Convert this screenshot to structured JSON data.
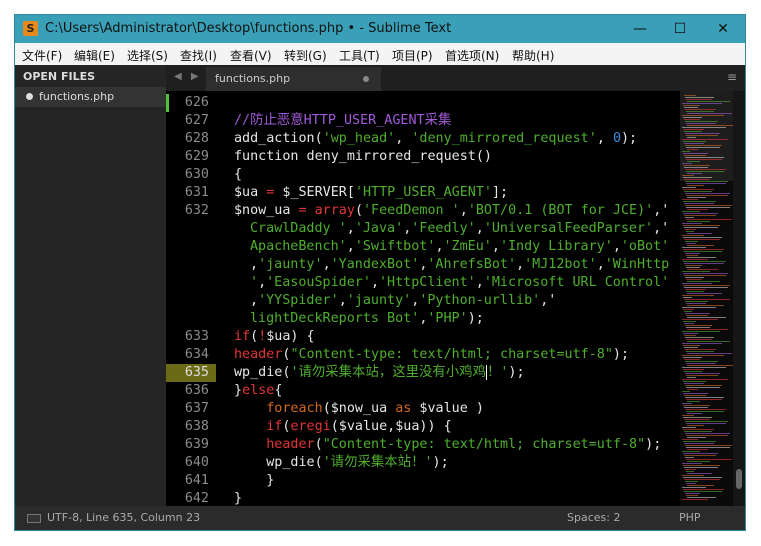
{
  "window": {
    "title": "C:\\Users\\Administrator\\Desktop\\functions.php • - Sublime Text",
    "app_icon": "S",
    "controls": {
      "minimize": "—",
      "maximize": "☐",
      "close": "✕"
    }
  },
  "menu": [
    "文件(F)",
    "编辑(E)",
    "选择(S)",
    "查找(I)",
    "查看(V)",
    "转到(G)",
    "工具(T)",
    "项目(P)",
    "首选项(N)",
    "帮助(H)"
  ],
  "sidebar": {
    "header": "OPEN FILES",
    "files": [
      {
        "name": "functions.php"
      }
    ]
  },
  "tabs": [
    {
      "label": "functions.php",
      "dirty": true
    }
  ],
  "tab_nav": "◀ ▶",
  "tab_menu_icon": "≡",
  "editor": {
    "modified_line": 626,
    "current_line": 635,
    "lines": [
      {
        "n": "626",
        "t": []
      },
      {
        "n": "627",
        "t": [
          [
            "//防止恶意HTTP_USER_AGENT采集",
            "c"
          ]
        ]
      },
      {
        "n": "628",
        "t": [
          [
            "add_action(",
            ""
          ],
          [
            "'wp_head'",
            "s"
          ],
          [
            ", ",
            ""
          ],
          [
            "'deny_mirrored_request'",
            "s"
          ],
          [
            ", ",
            ""
          ],
          [
            "0",
            "n"
          ],
          [
            ");",
            ""
          ]
        ]
      },
      {
        "n": "629",
        "t": [
          [
            "function deny_mirrored_request()",
            ""
          ]
        ]
      },
      {
        "n": "630",
        "t": [
          [
            "{",
            ""
          ]
        ]
      },
      {
        "n": "631",
        "t": [
          [
            "$ua ",
            ""
          ],
          [
            "=",
            "k"
          ],
          [
            " $_SERVER[",
            ""
          ],
          [
            "'HTTP_USER_AGENT'",
            "s"
          ],
          [
            "];",
            ""
          ]
        ]
      },
      {
        "n": "632",
        "t": [
          [
            "$now_ua ",
            ""
          ],
          [
            "= array",
            "k"
          ],
          [
            "(",
            ""
          ],
          [
            "'FeedDemon '",
            "s"
          ],
          [
            ",",
            ""
          ],
          [
            "'BOT/0.1 (BOT for JCE)'",
            "s"
          ],
          [
            ",'",
            ""
          ]
        ]
      },
      {
        "n": "",
        "t": [
          [
            "CrawlDaddy '",
            "s"
          ],
          [
            ",",
            ""
          ],
          [
            "'Java'",
            "s"
          ],
          [
            ",",
            ""
          ],
          [
            "'Feedly'",
            "s"
          ],
          [
            ",",
            ""
          ],
          [
            "'UniversalFeedParser'",
            "s"
          ],
          [
            ",'",
            ""
          ]
        ]
      },
      {
        "n": "",
        "t": [
          [
            "ApacheBench'",
            "s"
          ],
          [
            ",",
            ""
          ],
          [
            "'Swiftbot'",
            "s"
          ],
          [
            ",",
            ""
          ],
          [
            "'ZmEu'",
            "s"
          ],
          [
            ",",
            ""
          ],
          [
            "'Indy Library'",
            "s"
          ],
          [
            ",",
            ""
          ],
          [
            "'oBot'",
            "s"
          ]
        ]
      },
      {
        "n": "",
        "t": [
          [
            ",",
            ""
          ],
          [
            "'jaunty'",
            "s"
          ],
          [
            ",",
            ""
          ],
          [
            "'YandexBot'",
            "s"
          ],
          [
            ",",
            ""
          ],
          [
            "'AhrefsBot'",
            "s"
          ],
          [
            ",",
            ""
          ],
          [
            "'MJ12bot'",
            "s"
          ],
          [
            ",",
            ""
          ],
          [
            "'WinHttp",
            "s"
          ]
        ]
      },
      {
        "n": "",
        "t": [
          [
            "'",
            "s"
          ],
          [
            ",",
            ""
          ],
          [
            "'EasouSpider'",
            "s"
          ],
          [
            ",",
            ""
          ],
          [
            "'HttpClient'",
            "s"
          ],
          [
            ",",
            ""
          ],
          [
            "'Microsoft URL Control'",
            "s"
          ]
        ]
      },
      {
        "n": "",
        "t": [
          [
            ",",
            ""
          ],
          [
            "'YYSpider'",
            "s"
          ],
          [
            ",",
            ""
          ],
          [
            "'jaunty'",
            "s"
          ],
          [
            ",",
            ""
          ],
          [
            "'Python-urllib'",
            "s"
          ],
          [
            ",'",
            ""
          ]
        ]
      },
      {
        "n": "",
        "t": [
          [
            "lightDeckReports Bot'",
            "s"
          ],
          [
            ",",
            ""
          ],
          [
            "'PHP'",
            "s"
          ],
          [
            ");",
            ""
          ]
        ]
      },
      {
        "n": "633",
        "t": [
          [
            "if",
            "k"
          ],
          [
            "(",
            ""
          ],
          [
            "!",
            "k"
          ],
          [
            "$ua) {",
            ""
          ]
        ]
      },
      {
        "n": "634",
        "t": [
          [
            "header",
            "k"
          ],
          [
            "(",
            ""
          ],
          [
            "\"Content-type: text/html; charset=utf-8\"",
            "s"
          ],
          [
            ");",
            ""
          ]
        ]
      },
      {
        "n": "635",
        "t": [
          [
            "wp_die(",
            ""
          ],
          [
            "'请勿采集本站，这里没有小鸡鸡",
            "s"
          ],
          [
            "|",
            "cursor"
          ],
          [
            "！'",
            "s"
          ],
          [
            ");",
            ""
          ]
        ]
      },
      {
        "n": "636",
        "t": [
          [
            "}",
            ""
          ],
          [
            "else",
            "k"
          ],
          [
            "{",
            ""
          ]
        ]
      },
      {
        "n": "637",
        "t": [
          [
            "    ",
            ""
          ],
          [
            "foreach",
            "o"
          ],
          [
            "($now_ua ",
            ""
          ],
          [
            "as",
            "o"
          ],
          [
            " $value )",
            ""
          ]
        ]
      },
      {
        "n": "638",
        "t": [
          [
            "    ",
            ""
          ],
          [
            "if",
            "k"
          ],
          [
            "(",
            ""
          ],
          [
            "eregi",
            "k"
          ],
          [
            "($value,$ua)) {",
            ""
          ]
        ]
      },
      {
        "n": "639",
        "t": [
          [
            "    ",
            ""
          ],
          [
            "header",
            "k"
          ],
          [
            "(",
            ""
          ],
          [
            "\"Content-type: text/html; charset=utf-8\"",
            "s"
          ],
          [
            ");",
            ""
          ]
        ]
      },
      {
        "n": "640",
        "t": [
          [
            "    wp_die(",
            ""
          ],
          [
            "'请勿采集本站！'",
            "s"
          ],
          [
            ");",
            ""
          ]
        ]
      },
      {
        "n": "641",
        "t": [
          [
            "    }",
            ""
          ]
        ]
      },
      {
        "n": "642",
        "t": [
          [
            "}",
            ""
          ]
        ]
      }
    ]
  },
  "status": {
    "position": "UTF-8, Line 635, Column 23",
    "indent": "Spaces: 2",
    "syntax": "PHP"
  }
}
